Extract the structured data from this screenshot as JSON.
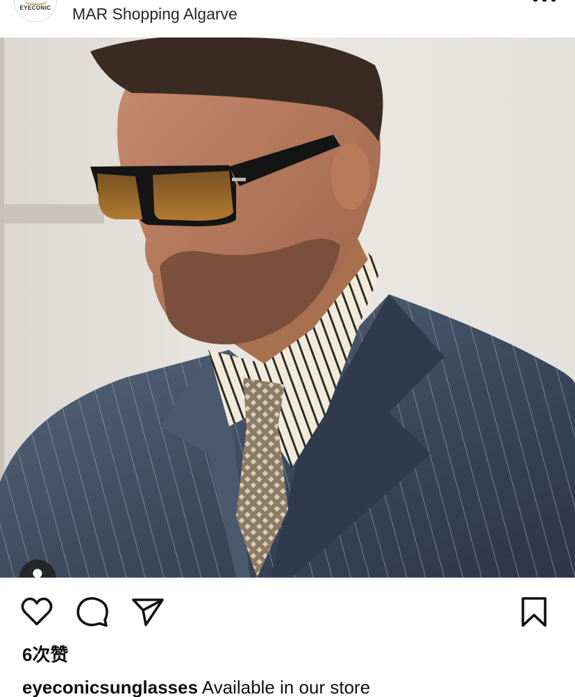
{
  "header": {
    "avatar_text": "EYECONIC",
    "location": "MAR Shopping Algarve"
  },
  "post": {
    "likes_text": "6次赞",
    "caption_user": "eyeconicsunglasses",
    "caption_text": "Available in our store"
  },
  "icons": {
    "like": "heart-icon",
    "comment": "comment-icon",
    "share": "send-icon",
    "save": "bookmark-icon",
    "more": "more-icon",
    "tag": "person-icon"
  }
}
